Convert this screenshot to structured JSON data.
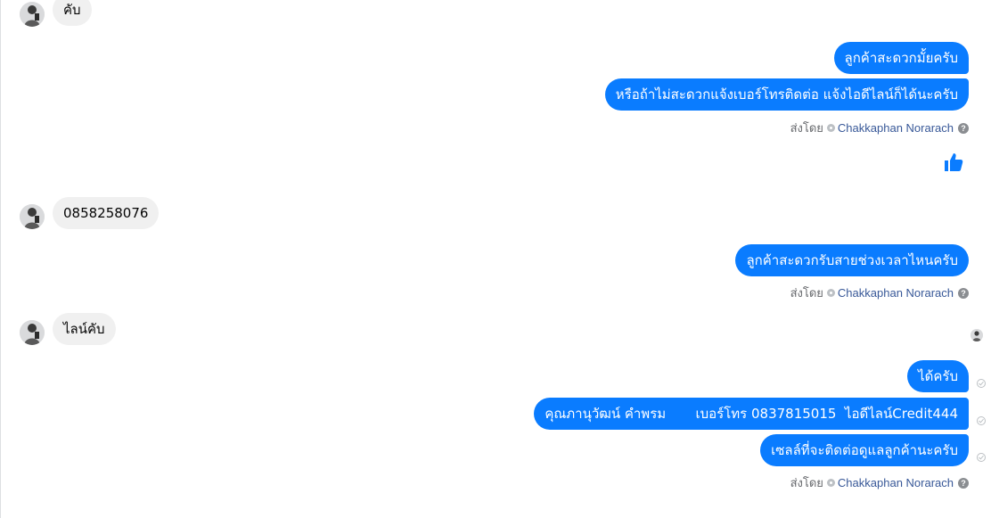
{
  "conversation": {
    "incoming": [
      {
        "text": "คับ"
      },
      {
        "text": "0858258076"
      },
      {
        "text": "ไลน์คับ"
      }
    ],
    "outgoing_group1": [
      {
        "text": "ลูกค้าสะดวกมั้ยครับ"
      },
      {
        "text": "หรือถ้าไม่สะดวกแจ้งเบอร์โทรติดต่อ แจ้งไอดีไลน์ก็ได้นะครับ"
      }
    ],
    "outgoing_group2": [
      {
        "text": "ลูกค้าสะดวกรับสายช่วงเวลาไหนครับ"
      }
    ],
    "outgoing_group3": [
      {
        "text": "ได้ครับ"
      },
      {
        "text": "คุณภานุวัฒน์ คำพรม       เบอร์โทร 0837815015  ไอดีไลน์Credit444"
      },
      {
        "text": "เซลล์ที่จะติดต่อดูแลลูกค้านะครับ"
      }
    ],
    "sent_by": {
      "prefix": "ส่งโดย",
      "name": "Chakkaphan Norarach",
      "help": "?"
    }
  },
  "colors": {
    "outgoing_bubble": "#0a7cff",
    "incoming_bubble": "#f0f0f0",
    "sender_name": "#385898"
  },
  "icons": {
    "like": "thumbs-up-icon",
    "delivered": "check-circle-icon",
    "seen": "read-receipt-avatar"
  }
}
